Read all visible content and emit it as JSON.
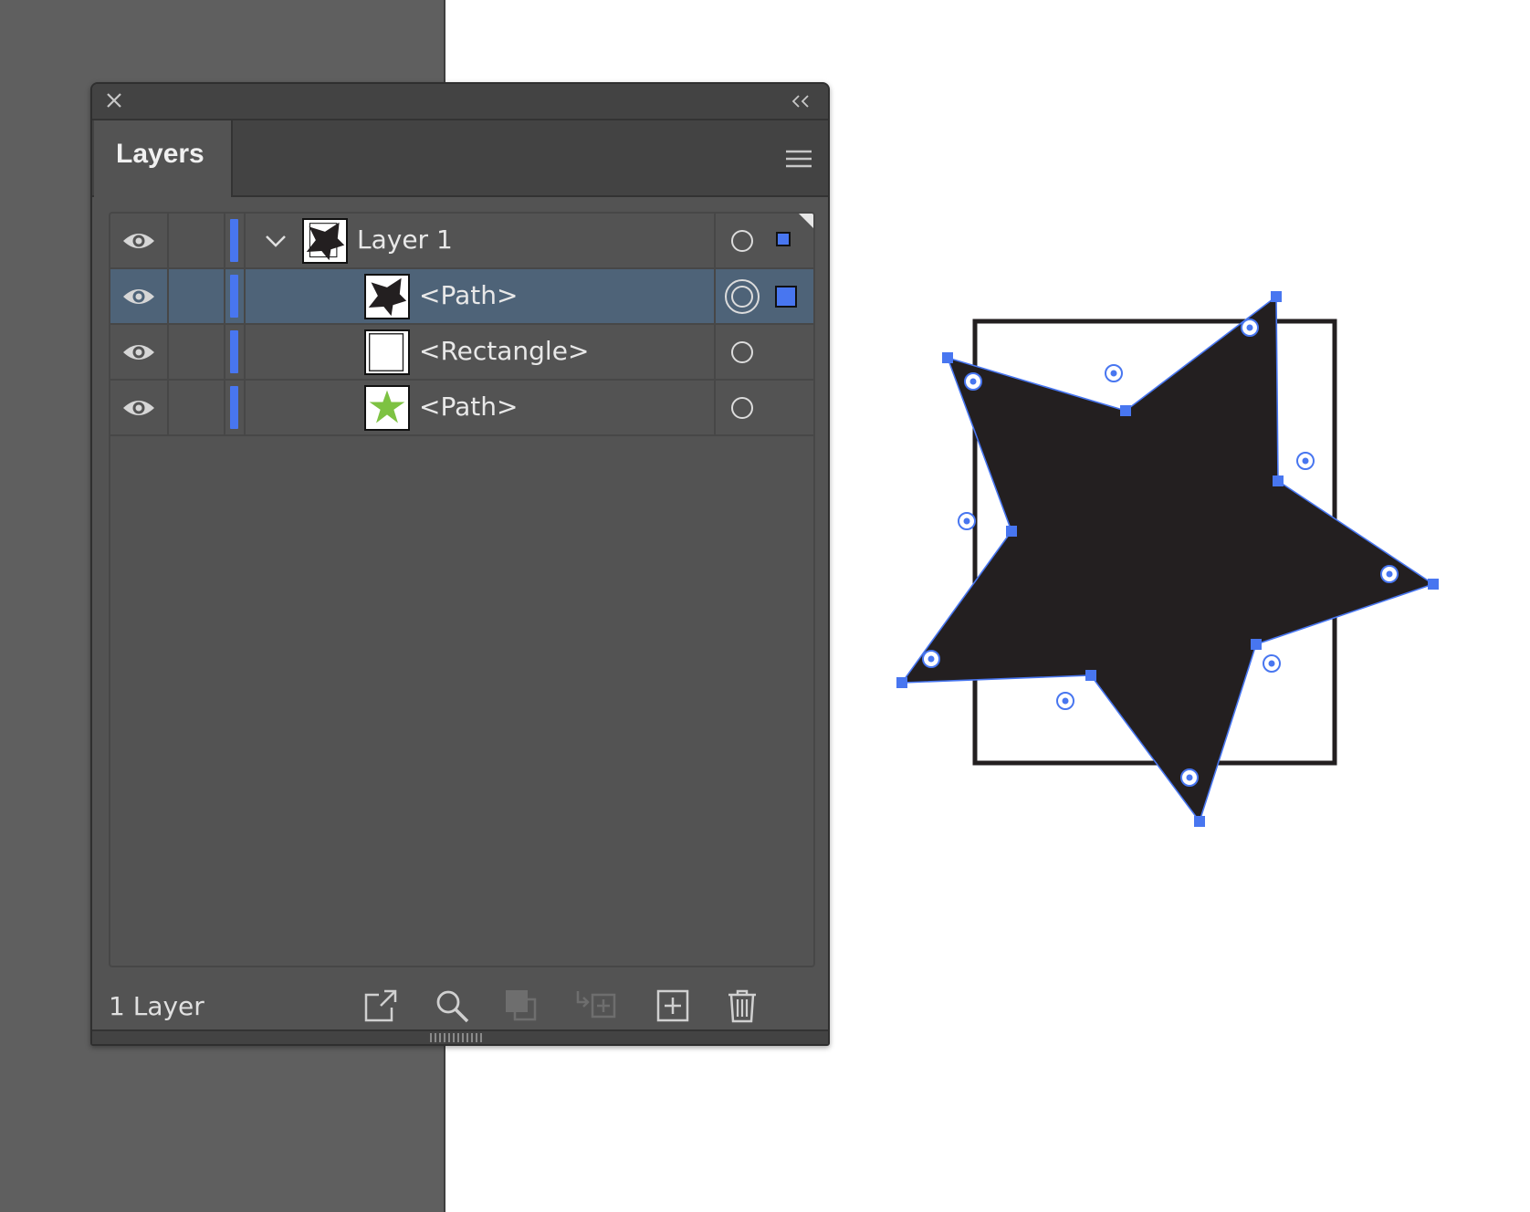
{
  "panel": {
    "tab_label": "Layers",
    "footer_count": "1 Layer",
    "icons": {
      "close": "close-icon",
      "collapse": "double-chevron-left-icon",
      "menu": "hamburger-menu-icon",
      "footer": [
        "export-to-asset-icon",
        "search-icon",
        "clipping-mask-icon",
        "sublayer-icon",
        "new-layer-icon",
        "trash-icon"
      ]
    }
  },
  "layers": [
    {
      "name": "Layer 1",
      "level": 0,
      "expanded": true,
      "selected": false,
      "thumbnail": "black-star-and-rectangle",
      "visible": true
    },
    {
      "name": "<Path>",
      "level": 1,
      "selected": true,
      "thumbnail": "black-star",
      "visible": true
    },
    {
      "name": "<Rectangle>",
      "level": 1,
      "selected": false,
      "thumbnail": "white-rectangle",
      "visible": true
    },
    {
      "name": "<Path>",
      "level": 1,
      "selected": false,
      "thumbnail": "green-star",
      "visible": true
    }
  ],
  "colors": {
    "layer_color": "#4876f0",
    "selected_row": "#4e6378",
    "panel_bg": "#535353",
    "star_fill": "#231f20",
    "thumb_green": "#7dc242"
  }
}
